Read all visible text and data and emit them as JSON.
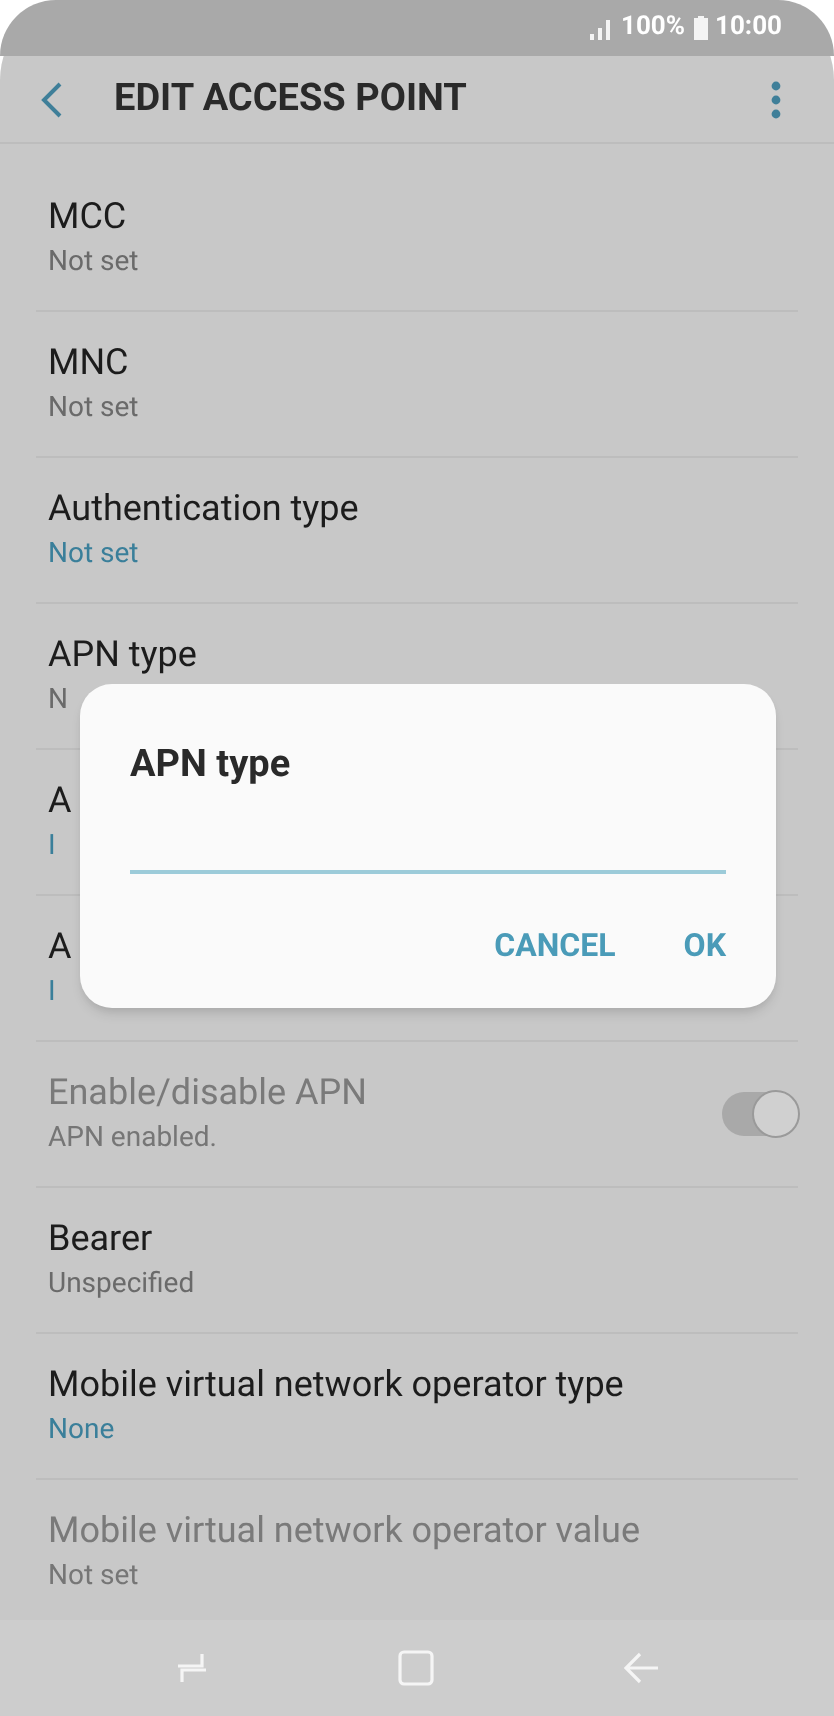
{
  "status_bar": {
    "battery": "100%",
    "time": "10:00"
  },
  "header": {
    "title": "EDIT ACCESS POINT"
  },
  "rows": [
    {
      "kind": "text",
      "title": "MCC",
      "value": "Not set",
      "accent": false,
      "disabled": false
    },
    {
      "kind": "text",
      "title": "MNC",
      "value": "Not set",
      "accent": false,
      "disabled": false
    },
    {
      "kind": "text",
      "title": "Authentication type",
      "value": "Not set",
      "accent": true,
      "disabled": false
    },
    {
      "kind": "text",
      "title": "APN type",
      "value": "N",
      "accent": false,
      "disabled": false
    },
    {
      "kind": "text",
      "title": "A",
      "value": "I",
      "accent": true,
      "disabled": false
    },
    {
      "kind": "text",
      "title": "A",
      "value": "I",
      "accent": true,
      "disabled": false
    },
    {
      "kind": "switch",
      "title": "Enable/disable APN",
      "value": "APN enabled.",
      "on": true,
      "disabled": true
    },
    {
      "kind": "text",
      "title": "Bearer",
      "value": "Unspecified",
      "accent": false,
      "disabled": false
    },
    {
      "kind": "text",
      "title": "Mobile virtual network operator type",
      "value": "None",
      "accent": true,
      "disabled": false
    },
    {
      "kind": "text",
      "title": "Mobile virtual network operator value",
      "value": "Not set",
      "accent": false,
      "disabled": true
    }
  ],
  "dialog": {
    "title": "APN type",
    "buttons": [
      "CANCEL",
      "OK"
    ]
  }
}
